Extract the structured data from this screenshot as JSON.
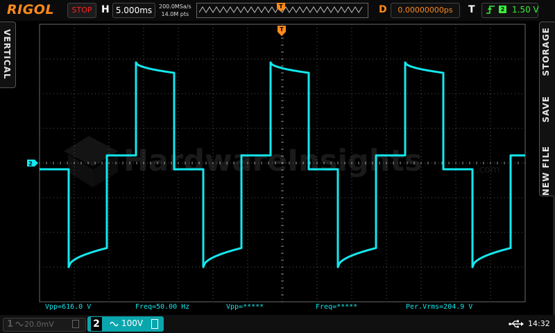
{
  "topbar": {
    "brand": "RIGOL",
    "run_state": "STOP",
    "horizontal_label": "H",
    "timebase": "5.000ms",
    "sample_rate": "200.0MSa/s",
    "memory_depth": "14.0M pts",
    "trigger_position_marker": "T",
    "delay_label": "D",
    "delay_value": "0.00000000ps",
    "trigger_label": "T",
    "trigger_source": "2",
    "trigger_level": "1.50 V"
  },
  "side_tabs": {
    "left": "VERTICAL",
    "right": [
      "STORAGE",
      "SAVE",
      "NEW FILE"
    ]
  },
  "screen": {
    "watermark": "HardwareInsights",
    "watermark_suffix": ".com",
    "channel_marker": "2",
    "trigger_marker": "T"
  },
  "measurements": [
    "Vpp=616.0 V",
    "Freq=50.00 Hz",
    "Vpp=*****",
    "Freq=*****",
    "Per.Vrms=204.9 V"
  ],
  "channels": [
    {
      "number": "1",
      "coupling_icon": "ac-coupling-icon",
      "scale": "20.0mV",
      "bandwidth_icon": "bandwidth-limit-icon",
      "active": false
    },
    {
      "number": "2",
      "coupling_icon": "ac-coupling-icon",
      "scale": "100V",
      "bandwidth_icon": "bandwidth-limit-icon",
      "active": true
    }
  ],
  "status": {
    "usb_icon": "usb-icon",
    "time": "14:32"
  },
  "colors": {
    "trace": "#13e8ee",
    "brand": "#ff8a1c",
    "stop": "#ff2020",
    "trigger": "#3aef3a"
  },
  "chart_data": {
    "type": "line",
    "x_unit": "ms",
    "y_unit": "V",
    "xlim": [
      -35,
      35
    ],
    "ylim": [
      -400,
      400
    ],
    "x_divisions": 14,
    "y_divisions": 8,
    "grid": true,
    "series": [
      {
        "name": "CH2",
        "frequency_hz": 50,
        "period_ms": 20,
        "waveform": "modified sine (stepped square)",
        "levels_v": {
          "pos_peak": 290,
          "pos_peak_end": 260,
          "pos_step": 22,
          "neg_step": -18,
          "neg_peak": -300,
          "neg_peak_end": -245
        },
        "phase_durations_ms": {
          "pos_step": 4.2,
          "pos_peak": 5.5,
          "neg_step": 4.2,
          "neg_peak": 5.5
        },
        "first_negative_step_start_ms": -35
      }
    ]
  }
}
